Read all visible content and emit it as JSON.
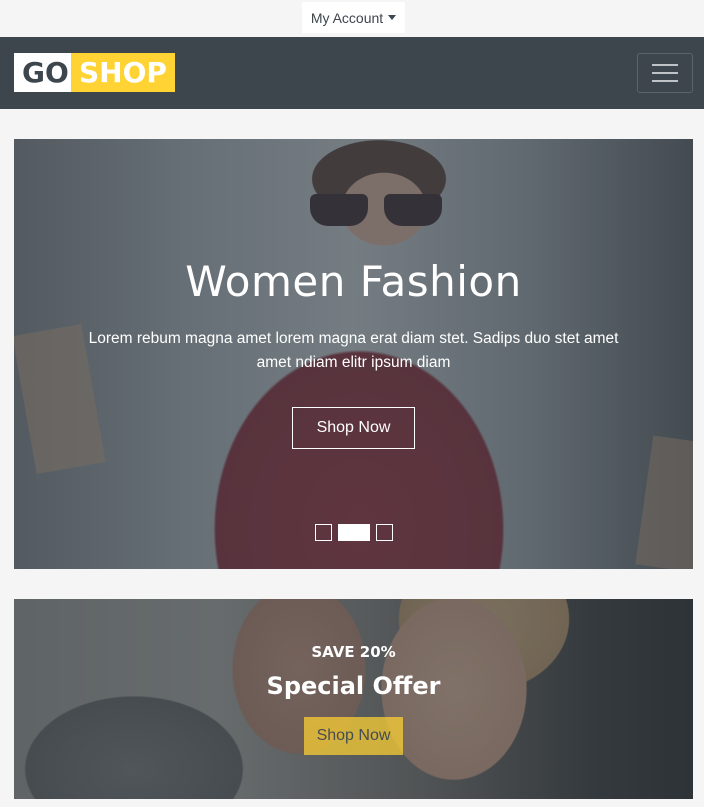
{
  "topbar": {
    "account_label": "My Account"
  },
  "navbar": {
    "logo": {
      "part1": "GO",
      "part2": "SHOP"
    },
    "colors": {
      "background": "#3d464d",
      "accent": "#ffd333"
    }
  },
  "hero": {
    "title": "Women Fashion",
    "text": "Lorem rebum magna amet lorem magna erat diam stet. Sadips duo stet amet amet ndiam elitr ipsum diam",
    "button_label": "Shop Now",
    "slides": 3,
    "active_slide": 2
  },
  "offer": {
    "subtitle": "SAVE 20%",
    "title": "Special Offer",
    "button_label": "Shop Now"
  }
}
